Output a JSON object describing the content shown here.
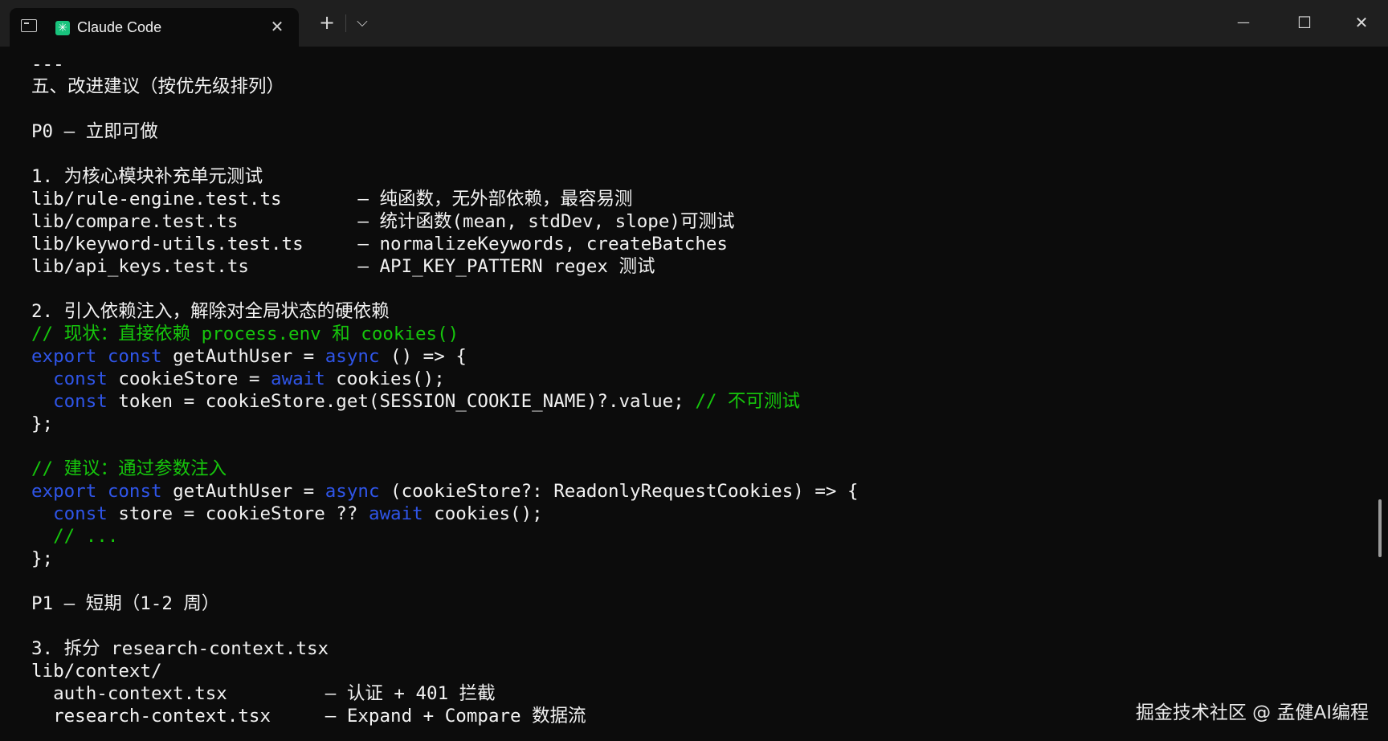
{
  "window": {
    "tab_title": "Claude Code",
    "tab_close": "✕",
    "new_tab": "+",
    "dropdown": "⌵",
    "minimize": "—",
    "maximize": "☐",
    "close": "✕"
  },
  "terminal": {
    "l01": "---",
    "l02": "五、改进建议（按优先级排列）",
    "l04": "P0 — 立即可做",
    "l06": "1. 为核心模块补充单元测试",
    "l07": "lib/rule-engine.test.ts       — 纯函数，无外部依赖，最容易测",
    "l08": "lib/compare.test.ts           — 统计函数(mean, stdDev, slope)可测试",
    "l09": "lib/keyword-utils.test.ts     — normalizeKeywords, createBatches",
    "l10": "lib/api_keys.test.ts          — API_KEY_PATTERN regex 测试",
    "l12": "2. 引入依赖注入，解除对全局状态的硬依赖",
    "l13": "// 现状：直接依赖 process.env 和 cookies()",
    "l14_kw1": "export",
    "l14_kw2": "const",
    "l14_a": " getAuthUser = ",
    "l14_kw3": "async",
    "l14_b": " () => {",
    "l15_kw1": "const",
    "l15_a": " cookieStore = ",
    "l15_kw2": "await",
    "l15_b": " cookies();",
    "l16_kw1": "const",
    "l16_a": " token = cookieStore.get(SESSION_COOKIE_NAME)?.value; ",
    "l16_cm": "// 不可测试",
    "l17": "};",
    "l19": "// 建议：通过参数注入",
    "l20_kw1": "export",
    "l20_kw2": "const",
    "l20_a": " getAuthUser = ",
    "l20_kw3": "async",
    "l20_b": " (cookieStore?: ReadonlyRequestCookies) => {",
    "l21_kw1": "const",
    "l21_a": " store = cookieStore ?? ",
    "l21_kw2": "await",
    "l21_b": " cookies();",
    "l22": "// ...",
    "l23": "};",
    "l25": "P1 — 短期（1-2 周）",
    "l27": "3. 拆分 research-context.tsx",
    "l28": "lib/context/",
    "l29": "auth-context.tsx         — 认证 + 401 拦截",
    "l30": "research-context.tsx     — Expand + Compare 数据流"
  },
  "watermark": "掘金技术社区 @ 孟健AI编程"
}
